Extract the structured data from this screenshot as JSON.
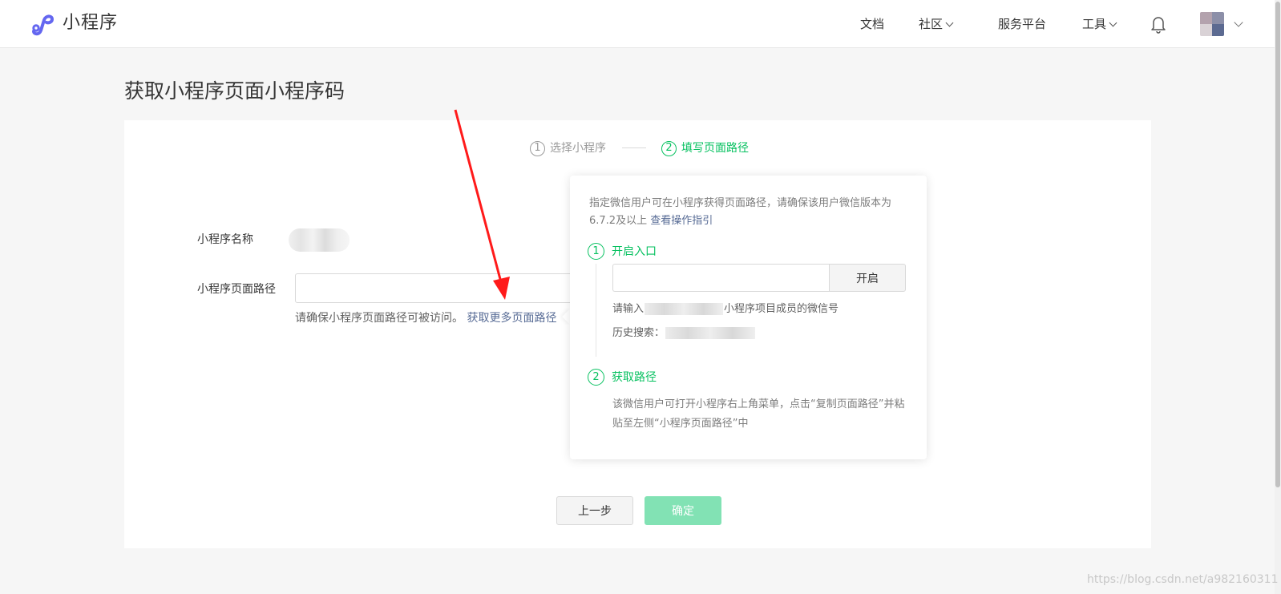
{
  "header": {
    "brand": "小程序",
    "nav": {
      "docs": "文档",
      "community": "社区",
      "service_platform": "服务平台",
      "tools": "工具"
    }
  },
  "page": {
    "title": "获取小程序页面小程序码"
  },
  "steps": [
    {
      "num": "1",
      "label": "选择小程序",
      "state": "done"
    },
    {
      "num": "2",
      "label": "填写页面路径",
      "state": "active"
    }
  ],
  "form": {
    "name_label": "小程序名称",
    "path_label": "小程序页面路径",
    "path_value": "",
    "hint_text": "请确保小程序页面路径可被访问。",
    "hint_link": "获取更多页面路径"
  },
  "popover": {
    "desc_text": "指定微信用户可在小程序获得页面路径，请确保该用户微信版本为6.7.2及以上",
    "desc_link": "查看操作指引",
    "step1": {
      "num": "1",
      "title": "开启入口"
    },
    "wechat_input_value": "",
    "open_button": "开启",
    "member_hint_prefix": "请输入",
    "member_hint_suffix": "小程序项目成员的微信号",
    "history_label": "历史搜索：",
    "step2": {
      "num": "2",
      "title": "获取路径"
    },
    "step2_note": "该微信用户可打开小程序右上角菜单，点击“复制页面路径”并粘贴至左侧“小程序页面路径”中"
  },
  "buttons": {
    "prev": "上一步",
    "confirm": "确定"
  },
  "colors": {
    "accent_green": "#07c160",
    "disabled_green": "#82e2b4",
    "link_blue": "#576b95",
    "annotation_red": "#ff1a1a"
  },
  "icons": {
    "logo": "mini-program-logo-icon",
    "bell": "bell-icon",
    "chevron": "chevron-down-icon"
  },
  "watermark": "https://blog.csdn.net/a982160311"
}
